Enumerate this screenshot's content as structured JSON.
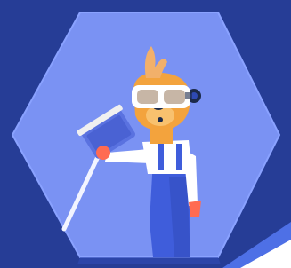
{
  "scene": {
    "subject": "meerkat-mascot-with-goggles-holding-scraper",
    "colors": {
      "background": "#263d96",
      "hexagon_fill": "#7a92f3",
      "hexagon_stroke": "#8aa2ff",
      "hex_edge_shadow": "#2f4ab3",
      "white_card": "#ffffff",
      "card_edge": "#4e70e6",
      "fur": "#f3a33d",
      "fur_light": "#f8c16e",
      "ear": "#f2b06a",
      "nose": "#1c2a4a",
      "goggle_frame": "#ffffff",
      "goggle_lens": "#c7b6a6",
      "overalls": "#3f5ddb",
      "shirt": "#ffffff",
      "hand": "#ff6b52",
      "tool_pole": "#f2f4ff",
      "tool_head": "#5a72e0",
      "tool_blade": "#f0f0f0"
    }
  }
}
